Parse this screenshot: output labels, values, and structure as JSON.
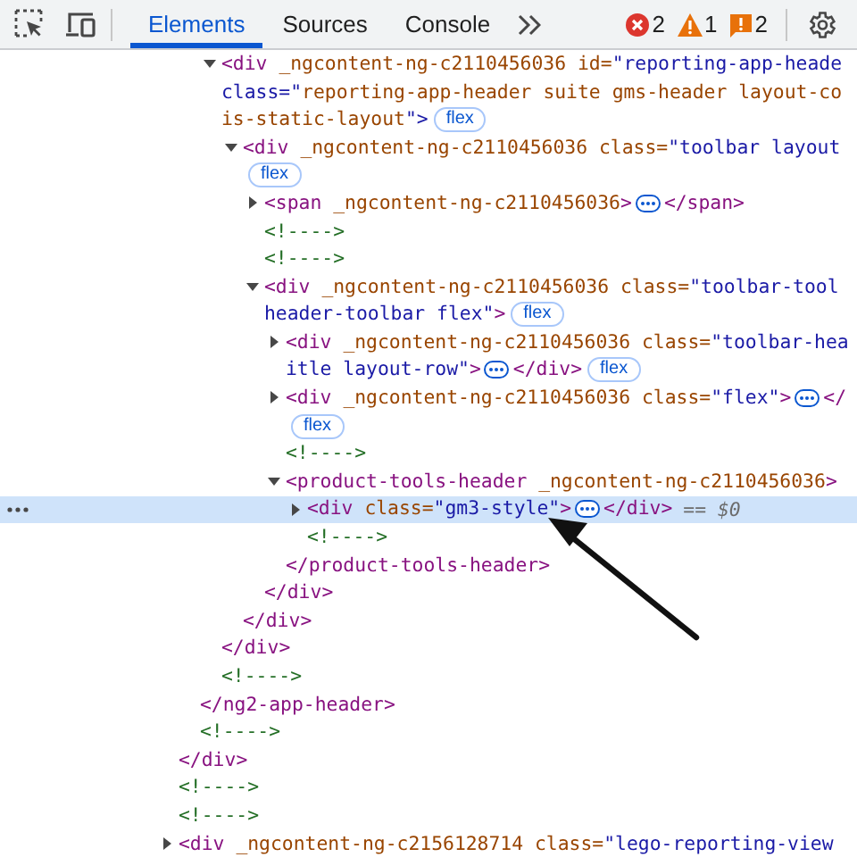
{
  "toolbar": {
    "tabs": [
      {
        "label": "Elements",
        "selected": true
      },
      {
        "label": "Sources",
        "selected": false
      },
      {
        "label": "Console",
        "selected": false
      }
    ],
    "counters": [
      {
        "kind": "error",
        "count": "2"
      },
      {
        "kind": "warning",
        "count": "1"
      },
      {
        "kind": "issue",
        "count": "2"
      }
    ]
  },
  "elements_tree": [
    {
      "kind": "tail",
      "selected": false,
      "close": "</div>",
      "children": [
        {
          "kind": "tail",
          "selected": false,
          "close": "</ng2-app-header>",
          "children": [
            {
              "kind": "element",
              "expanded": true,
              "selected": false,
              "lines": [
                [
                  {
                    "kind": "code",
                    "text": "<div _ngcontent-ng-c2110456036 id=\"reporting-app-heade"
                  }
                ],
                [
                  {
                    "kind": "code",
                    "text": "class=\"reporting-app-header suite gms-header layout-co"
                  }
                ],
                [
                  {
                    "kind": "code",
                    "text": "is-static-layout\">"
                  },
                  {
                    "kind": "badge",
                    "text": "flex"
                  }
                ]
              ],
              "close": "</div>",
              "children": [
                {
                  "kind": "element",
                  "expanded": true,
                  "selected": false,
                  "lines": [
                    [
                      {
                        "kind": "code",
                        "text": "<div _ngcontent-ng-c2110456036 class=\"toolbar layout"
                      }
                    ],
                    [
                      {
                        "kind": "badge",
                        "text": "flex"
                      }
                    ]
                  ],
                  "close": "</div>",
                  "children": [
                    {
                      "kind": "element",
                      "expanded": false,
                      "selected": false,
                      "lines": [
                        [
                          {
                            "kind": "code",
                            "text": "<span _ngcontent-ng-c2110456036>"
                          },
                          {
                            "kind": "ellipsis"
                          },
                          {
                            "kind": "code",
                            "text": "</span>"
                          }
                        ]
                      ]
                    },
                    {
                      "kind": "comment",
                      "selected": false,
                      "lines": [
                        [
                          {
                            "kind": "code",
                            "text": "<!---->"
                          }
                        ]
                      ]
                    },
                    {
                      "kind": "comment",
                      "selected": false,
                      "lines": [
                        [
                          {
                            "kind": "code",
                            "text": "<!---->"
                          }
                        ]
                      ]
                    },
                    {
                      "kind": "element",
                      "expanded": true,
                      "selected": false,
                      "lines": [
                        [
                          {
                            "kind": "code",
                            "text": "<div _ngcontent-ng-c2110456036 class=\"toolbar-tool"
                          }
                        ],
                        [
                          {
                            "kind": "code",
                            "text": "header-toolbar flex\">"
                          },
                          {
                            "kind": "badge",
                            "text": "flex"
                          }
                        ]
                      ],
                      "close": "</div>",
                      "children": [
                        {
                          "kind": "element",
                          "expanded": false,
                          "selected": false,
                          "lines": [
                            [
                              {
                                "kind": "code",
                                "text": "<div _ngcontent-ng-c2110456036 class=\"toolbar-hea"
                              }
                            ],
                            [
                              {
                                "kind": "code",
                                "text": "itle layout-row\">"
                              },
                              {
                                "kind": "ellipsis"
                              },
                              {
                                "kind": "code",
                                "text": "</div>"
                              },
                              {
                                "kind": "badge",
                                "text": "flex"
                              }
                            ]
                          ]
                        },
                        {
                          "kind": "element",
                          "expanded": false,
                          "selected": false,
                          "lines": [
                            [
                              {
                                "kind": "code",
                                "text": "<div _ngcontent-ng-c2110456036 class=\"flex\">"
                              },
                              {
                                "kind": "ellipsis"
                              },
                              {
                                "kind": "code",
                                "text": "</"
                              }
                            ],
                            [
                              {
                                "kind": "badge",
                                "text": "flex"
                              }
                            ]
                          ]
                        },
                        {
                          "kind": "comment",
                          "selected": false,
                          "lines": [
                            [
                              {
                                "kind": "code",
                                "text": "<!---->"
                              }
                            ]
                          ]
                        },
                        {
                          "kind": "element",
                          "expanded": true,
                          "selected": false,
                          "lines": [
                            [
                              {
                                "kind": "code",
                                "text": "<product-tools-header _ngcontent-ng-c2110456036>"
                              }
                            ]
                          ],
                          "close": "</product-tools-header>",
                          "children": [
                            {
                              "kind": "element",
                              "expanded": false,
                              "selected": true,
                              "lines": [
                                [
                                  {
                                    "kind": "code",
                                    "text": "<div class=\"gm3-style\">"
                                  },
                                  {
                                    "kind": "ellipsis"
                                  },
                                  {
                                    "kind": "code",
                                    "text": "</div>"
                                  },
                                  {
                                    "kind": "ref",
                                    "text": "== *$0*"
                                  }
                                ]
                              ]
                            },
                            {
                              "kind": "comment",
                              "selected": false,
                              "lines": [
                                [
                                  {
                                    "kind": "code",
                                    "text": "<!---->"
                                  }
                                ]
                              ]
                            }
                          ]
                        }
                      ]
                    }
                  ]
                }
              ]
            },
            {
              "kind": "comment",
              "selected": false,
              "lines": [
                [
                  {
                    "kind": "code",
                    "text": "<!---->"
                  }
                ]
              ]
            }
          ]
        },
        {
          "kind": "comment",
          "selected": false,
          "lines": [
            [
              {
                "kind": "code",
                "text": "<!---->"
              }
            ]
          ]
        }
      ]
    },
    {
      "kind": "comment",
      "selected": false,
      "lines": [
        [
          {
            "kind": "code",
            "text": "<!---->"
          }
        ]
      ]
    },
    {
      "kind": "comment",
      "selected": false,
      "lines": [
        [
          {
            "kind": "code",
            "text": "<!---->"
          }
        ]
      ]
    },
    {
      "kind": "element",
      "expanded": false,
      "selected": false,
      "lines": [
        [
          {
            "kind": "code",
            "text": "<div _ngcontent-ng-c2156128714 class=\"lego-reporting-view"
          }
        ]
      ]
    }
  ],
  "annotation": {
    "kind": "arrow"
  }
}
